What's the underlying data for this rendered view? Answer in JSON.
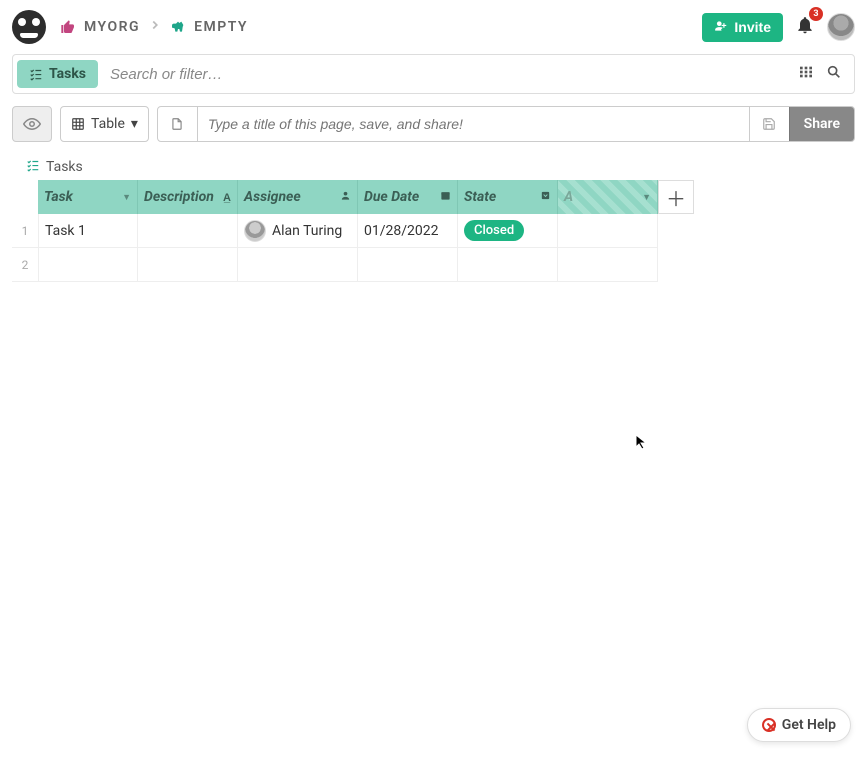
{
  "header": {
    "breadcrumb": {
      "org": "MYORG",
      "page": "EMPTY"
    },
    "invite_label": "Invite",
    "notification_count": "3"
  },
  "searchbar": {
    "chip_label": "Tasks",
    "placeholder": "Search or filter…"
  },
  "toolbar": {
    "view_label": "Table",
    "title_placeholder": "Type a title of this page, save, and share!",
    "share_label": "Share"
  },
  "table": {
    "title": "Tasks",
    "columns": [
      {
        "label": "Task"
      },
      {
        "label": "Description"
      },
      {
        "label": "Assignee"
      },
      {
        "label": "Due Date"
      },
      {
        "label": "State"
      },
      {
        "label": "A"
      }
    ],
    "rows": [
      {
        "task": "Task 1",
        "description": "",
        "assignee": "Alan Turing",
        "due_date": "01/28/2022",
        "state": "Closed",
        "extra": ""
      },
      {
        "task": "",
        "description": "",
        "assignee": "",
        "due_date": "",
        "state": "",
        "extra": ""
      }
    ]
  },
  "help": {
    "label": "Get Help"
  },
  "colors": {
    "accent": "#1db583",
    "header_green": "#8fd6c3",
    "danger": "#d93025"
  }
}
